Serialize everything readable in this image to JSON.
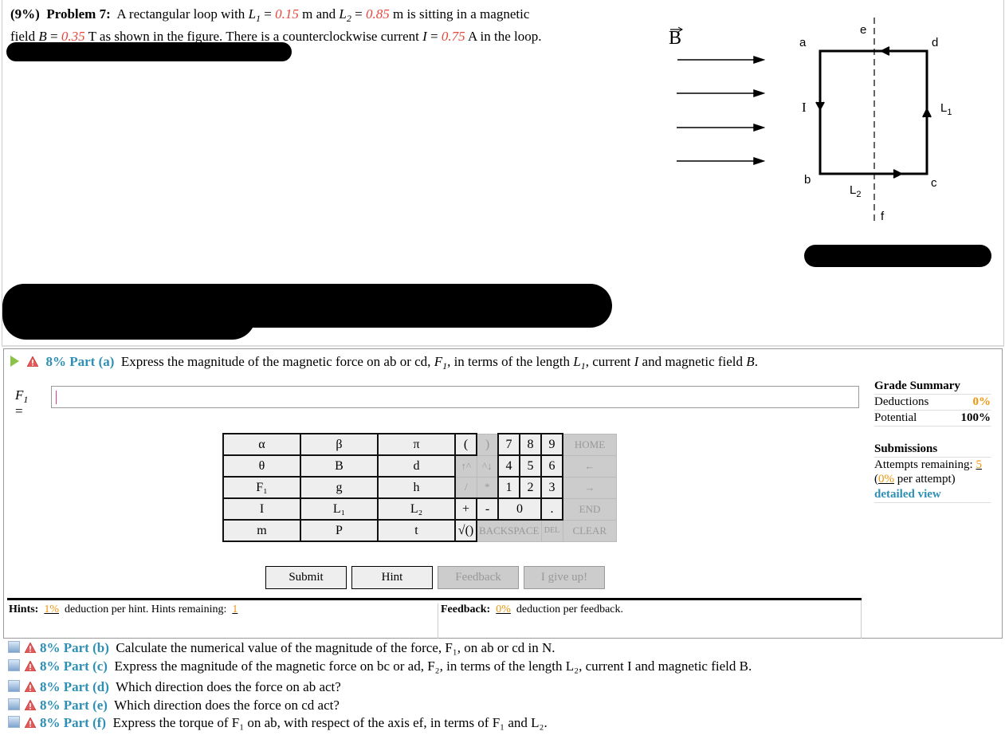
{
  "problem": {
    "weight": "(9%)",
    "title": "Problem 7:",
    "text_1": "A rectangular loop with",
    "L1_sym": "L",
    "L1_sub": "1",
    "eq": "=",
    "L1_val": "0.15",
    "unit_m1": "m and",
    "L2_sym": "L",
    "L2_sub": "2",
    "L2_val": "0.85",
    "text_2": "m is sitting in a magnetic",
    "text_3": "field",
    "B_sym": "B",
    "B_val": "0.35",
    "text_4": "T as shown in the figure. There is a counterclockwise current",
    "I_sym": "I",
    "I_val": "0.75",
    "text_5": "A in the loop."
  },
  "figure": {
    "B_label": "B",
    "a": "a",
    "b": "b",
    "c": "c",
    "d": "d",
    "e": "e",
    "f": "f",
    "I_label": "I",
    "L1_label": "L",
    "L1_sub": "1",
    "L2_label": "L",
    "L2_sub": "2"
  },
  "part_a": {
    "weight": "8%",
    "part": "Part (a)",
    "q_1": "Express the magnitude of the magnetic force on ab or cd,",
    "F": "F",
    "F_sub": "1",
    "q_2": ", in terms of the length",
    "L": "L",
    "L_sub": "1",
    "q_3": ", current",
    "I": "I",
    "q_4": "and magnetic field",
    "B": "B",
    "q_5": ".",
    "answer_label": "F",
    "answer_sub": "1",
    "answer_eq": "=",
    "answer_value": ""
  },
  "grade_summary": {
    "title": "Grade Summary",
    "deductions_label": "Deductions",
    "deductions_value": "0%",
    "potential_label": "Potential",
    "potential_value": "100%",
    "submissions_title": "Submissions",
    "attempts_label": "Attempts remaining:",
    "attempts_value": "5",
    "per_attempt_open": "(",
    "per_attempt_value": "0%",
    "per_attempt_label": "per attempt)",
    "detailed_view": "detailed view"
  },
  "keypad": {
    "symbols": [
      [
        "α",
        "β",
        "π"
      ],
      [
        "θ",
        "B",
        "d"
      ],
      [
        "F₁",
        "g",
        "h"
      ],
      [
        "I",
        "L₁",
        "L₂"
      ],
      [
        "m",
        "P",
        "t"
      ]
    ],
    "row1": [
      "(",
      ")",
      "7",
      "8",
      "9",
      "HOME"
    ],
    "row2": [
      "↑^",
      "^↓",
      "4",
      "5",
      "6",
      "←"
    ],
    "row3": [
      "/",
      "*",
      "1",
      "2",
      "3",
      "→"
    ],
    "row4": [
      "+",
      "-",
      "0",
      ".",
      "END"
    ],
    "row5": [
      "√()",
      "BACKSPACE",
      "DEL",
      "CLEAR"
    ]
  },
  "buttons": {
    "submit": "Submit",
    "hint": "Hint",
    "feedback": "Feedback",
    "give_up": "I give up!"
  },
  "hints": {
    "label": "Hints:",
    "deduction": "1%",
    "text": "deduction per hint. Hints remaining:",
    "remaining": "1"
  },
  "feedback": {
    "label": "Feedback:",
    "deduction": "0%",
    "text": "deduction per feedback."
  },
  "other_parts": [
    {
      "weight": "8%",
      "part": "Part (b)",
      "text": "Calculate the numerical value of the magnitude of the force, F₁, on ab or cd in N."
    },
    {
      "weight": "8%",
      "part": "Part (c)",
      "text": "Express the magnitude of the magnetic force on bc or ad, F₂, in terms of the length L₂, current I and magnetic field B."
    },
    {
      "weight": "8%",
      "part": "Part (d)",
      "text": "Which direction does the force on ab act?"
    },
    {
      "weight": "8%",
      "part": "Part (e)",
      "text": "Which direction does the force on cd act?"
    },
    {
      "weight": "8%",
      "part": "Part (f)",
      "text": "Express the torque of F₁ on ab, with respect of the axis ef, in terms of F₁ and L₂."
    }
  ]
}
